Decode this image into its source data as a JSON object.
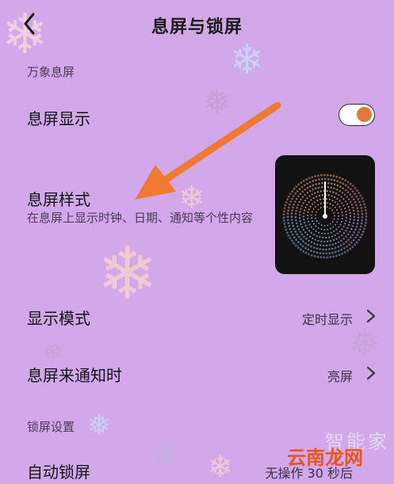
{
  "header": {
    "title": "息屏与锁屏"
  },
  "sections": {
    "aod": "万象息屏",
    "lock": "锁屏设置"
  },
  "rows": {
    "aod_display": {
      "label": "息屏显示",
      "toggle_on": true
    },
    "aod_style": {
      "label": "息屏样式",
      "description": "在息屏上显示时钟、日期、通知等个性内容"
    },
    "display_mode": {
      "label": "显示模式",
      "value": "定时显示"
    },
    "notify": {
      "label": "息屏来通知时",
      "value": "亮屏"
    },
    "auto_lock": {
      "label": "自动锁屏",
      "value": "无操作 30 秒后"
    }
  },
  "watermark": {
    "top": "智能家",
    "bottom": "云南龙网"
  },
  "colors": {
    "background": "#d3a8ea",
    "accent": "#e07a3c",
    "arrow": "#f07a32"
  },
  "icons": [
    "back-arrow-icon",
    "chevron-right-icon",
    "snowflake-icon"
  ]
}
